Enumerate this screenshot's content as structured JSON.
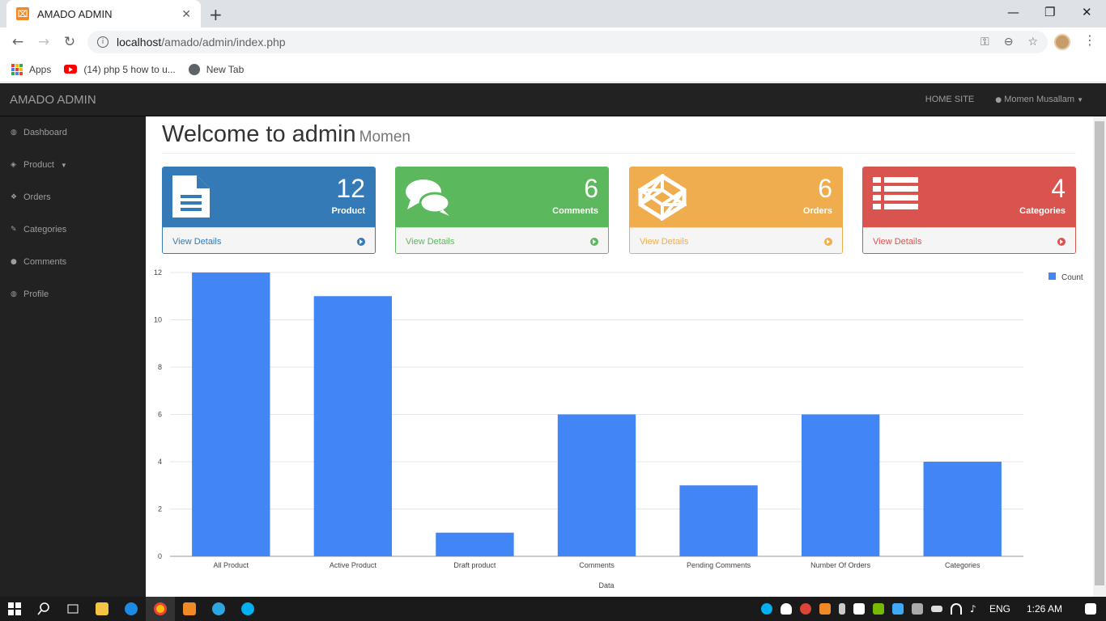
{
  "browser": {
    "tab_title": "AMADO ADMIN",
    "url_host": "localhost",
    "url_path": "/amado/admin/index.php",
    "bookmarks": [
      {
        "label": "Apps"
      },
      {
        "label": "(14) php 5 how to u..."
      },
      {
        "label": "New Tab"
      }
    ]
  },
  "app": {
    "brand": "AMADO ADMIN",
    "nav_home": "HOME SITE",
    "nav_user": "Momen Musallam",
    "sidebar": [
      {
        "label": "Dashboard",
        "icon": "dashboard-icon"
      },
      {
        "label": "Product",
        "icon": "cube-icon"
      },
      {
        "label": "Orders",
        "icon": "cubes-icon"
      },
      {
        "label": "Categories",
        "icon": "wrench-icon"
      },
      {
        "label": "Comments",
        "icon": "comment-icon"
      },
      {
        "label": "Profile",
        "icon": "dashboard-icon"
      }
    ],
    "header_title": "Welcome to admin",
    "header_sub": "Momen",
    "panels": [
      {
        "count": "12",
        "label": "Product",
        "link": "View Details",
        "color": "#337ab7",
        "icon": "document-icon"
      },
      {
        "count": "6",
        "label": "Comments",
        "link": "View Details",
        "color": "#5cb85c",
        "icon": "comments-icon"
      },
      {
        "count": "6",
        "label": "Orders",
        "link": "View Details",
        "color": "#f0ad4e",
        "icon": "codepen-icon"
      },
      {
        "count": "4",
        "label": "Categories",
        "link": "View Details",
        "color": "#d9534f",
        "icon": "list-icon"
      }
    ]
  },
  "chart_data": {
    "type": "bar",
    "categories": [
      "All Product",
      "Active Product",
      "Draft product",
      "Comments",
      "Pending Comments",
      "Number Of Orders",
      "Categories"
    ],
    "series": [
      {
        "name": "Count",
        "values": [
          12,
          11,
          1,
          6,
          3,
          6,
          4
        ]
      }
    ],
    "xlabel": "Data",
    "ylabel": "",
    "ylim": [
      0,
      12
    ],
    "yticks": [
      0,
      2,
      4,
      6,
      8,
      10,
      12
    ],
    "color": "#4285f4",
    "grid": true,
    "legend": "right"
  },
  "taskbar": {
    "lang": "ENG",
    "time": "1:26 AM"
  }
}
